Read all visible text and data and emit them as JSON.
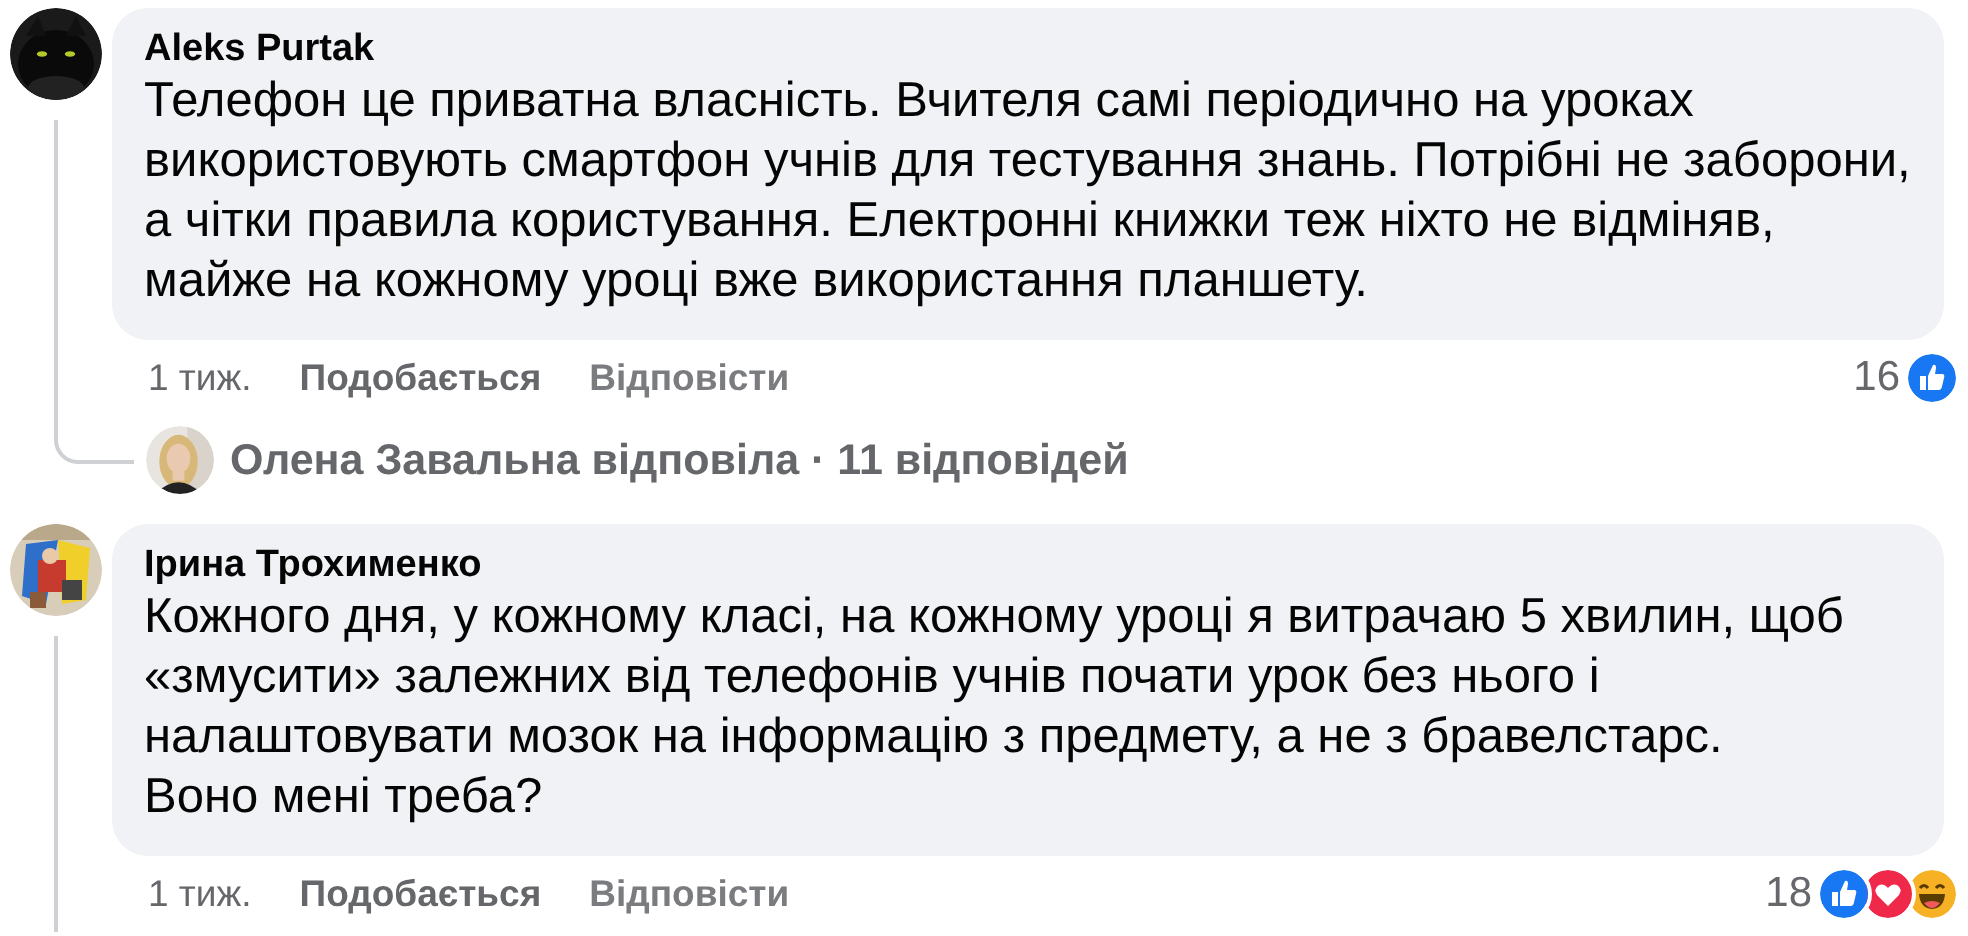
{
  "comments": [
    {
      "author": "Aleks Purtak",
      "avatar": {
        "kind": "picture"
      },
      "text": "Телефон це приватна власність. Вчителя самі періодично на уроках використовують смартфон учнів для тестування знань. Потрібні не заборони, а чітки правила користування. Електронні книжки теж ніхто не відміняв, майже на кожному уроці вже використання планшету.",
      "time": "1 тиж.",
      "actions": [
        "Подобається",
        "Відповісти"
      ],
      "reaction_count": "16",
      "reactions": [
        {
          "kind": "like"
        }
      ],
      "replies_summary": {
        "avatar": {
          "kind": "picture"
        },
        "text": "Олена Завальна відповіла · 11 відповідей"
      }
    },
    {
      "author": "Ірина Трохименко",
      "avatar": {
        "kind": "picture"
      },
      "text": "Кожного дня, у кожному класі, на кожному уроці я витрачаю 5 хвилин, щоб «змусити» залежних від телефонів учнів почати урок без нього і налаштовувати мозок на інформацію з предмету, а не з бравелстарс.\nВоно мені треба?",
      "time": "1 тиж.",
      "actions": [
        "Подобається",
        "Відповісти"
      ],
      "reaction_count": "18",
      "reactions": [
        {
          "kind": "like"
        },
        {
          "kind": "love"
        },
        {
          "kind": "haha"
        }
      ]
    }
  ]
}
